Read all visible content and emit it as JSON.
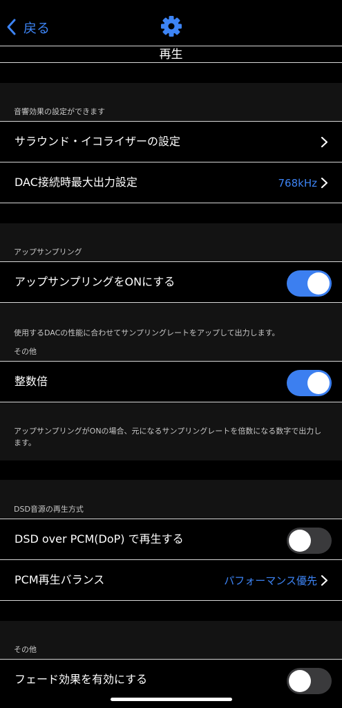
{
  "nav": {
    "back_label": "戻る"
  },
  "page": {
    "title": "再生"
  },
  "sections": {
    "effects": {
      "caption": "音響効果の設定ができます",
      "rows": [
        {
          "label": "サラウンド・イコライザーの設定",
          "value": ""
        },
        {
          "label": "DAC接続時最大出力設定",
          "value": "768kHz"
        }
      ]
    },
    "upsampling": {
      "caption": "アップサンプリング",
      "toggle_label": "アップサンプリングをONにする",
      "toggle_on": true,
      "footer": "使用するDACの性能に合わせてサンプリングレートをアップして出力します。"
    },
    "other": {
      "caption": "その他",
      "toggle_label": "整数倍",
      "toggle_on": true,
      "footer": "アップサンプリングがONの場合、元になるサンプリングレートを倍数になる数字で出力します。"
    },
    "dsd": {
      "caption": "DSD音源の再生方式",
      "toggle_label": "DSD over PCM(DoP) で再生する",
      "toggle_on": false,
      "balance_label": "PCM再生バランス",
      "balance_value": "パフォーマンス優先"
    },
    "other2": {
      "caption": "その他",
      "toggle_label": "フェード効果を有効にする",
      "toggle_on": false
    }
  },
  "colors": {
    "accent": "#3d84f5",
    "toggle_on": "#3c7ff0",
    "toggle_off": "#3a3a3c",
    "band": "#131313"
  },
  "icons": {
    "back": "chevron-left-icon",
    "settings": "gear-icon",
    "disclosure": "chevron-right-icon"
  }
}
